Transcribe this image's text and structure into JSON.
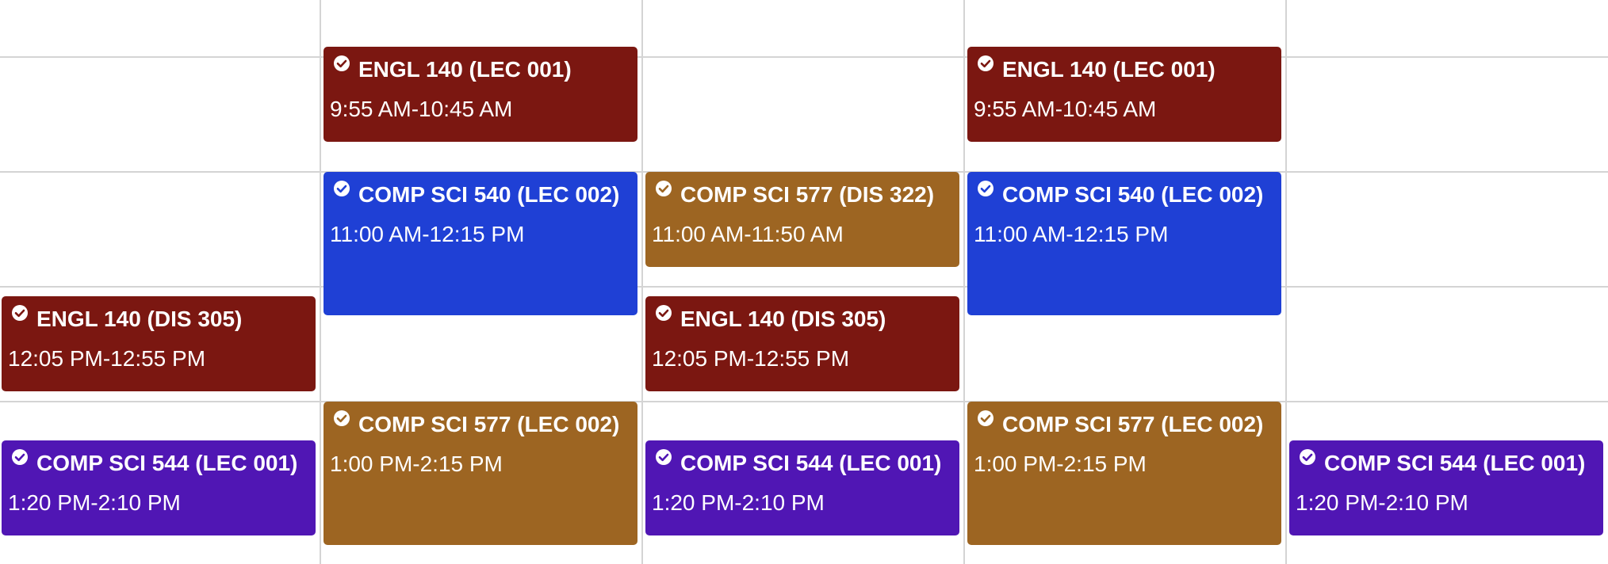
{
  "colors": {
    "maroon": "#7b1711",
    "blue": "#1f40d5",
    "brown": "#9d6522",
    "purple": "#5016b4",
    "gridline": "#d4d4d4"
  },
  "events": [
    {
      "title": "ENGL 140 (LEC 001)",
      "time": "9:55 AM-10:45 AM",
      "color": "#7b1711",
      "icon": "check-circle-icon"
    },
    {
      "title": "ENGL 140 (LEC 001)",
      "time": "9:55 AM-10:45 AM",
      "color": "#7b1711",
      "icon": "check-circle-icon"
    },
    {
      "title": "COMP SCI 540 (LEC 002)",
      "time": "11:00 AM-12:15 PM",
      "color": "#1f40d5",
      "icon": "check-circle-icon"
    },
    {
      "title": "COMP SCI 577 (DIS 322)",
      "time": "11:00 AM-11:50 AM",
      "color": "#9d6522",
      "icon": "check-circle-icon"
    },
    {
      "title": "COMP SCI 540 (LEC 002)",
      "time": "11:00 AM-12:15 PM",
      "color": "#1f40d5",
      "icon": "check-circle-icon"
    },
    {
      "title": "ENGL 140 (DIS 305)",
      "time": "12:05 PM-12:55 PM",
      "color": "#7b1711",
      "icon": "check-circle-icon"
    },
    {
      "title": "ENGL 140 (DIS 305)",
      "time": "12:05 PM-12:55 PM",
      "color": "#7b1711",
      "icon": "check-circle-icon"
    },
    {
      "title": "COMP SCI 577 (LEC 002)",
      "time": "1:00 PM-2:15 PM",
      "color": "#9d6522",
      "icon": "check-circle-icon"
    },
    {
      "title": "COMP SCI 577 (LEC 002)",
      "time": "1:00 PM-2:15 PM",
      "color": "#9d6522",
      "icon": "check-circle-icon"
    },
    {
      "title": "COMP SCI 544 (LEC 001)",
      "time": "1:20 PM-2:10 PM",
      "color": "#5016b4",
      "icon": "check-circle-icon"
    },
    {
      "title": "COMP SCI 544 (LEC 001)",
      "time": "1:20 PM-2:10 PM",
      "color": "#5016b4",
      "icon": "check-circle-icon"
    },
    {
      "title": "COMP SCI 544 (LEC 001)",
      "time": "1:20 PM-2:10 PM",
      "color": "#5016b4",
      "icon": "check-circle-icon"
    }
  ]
}
